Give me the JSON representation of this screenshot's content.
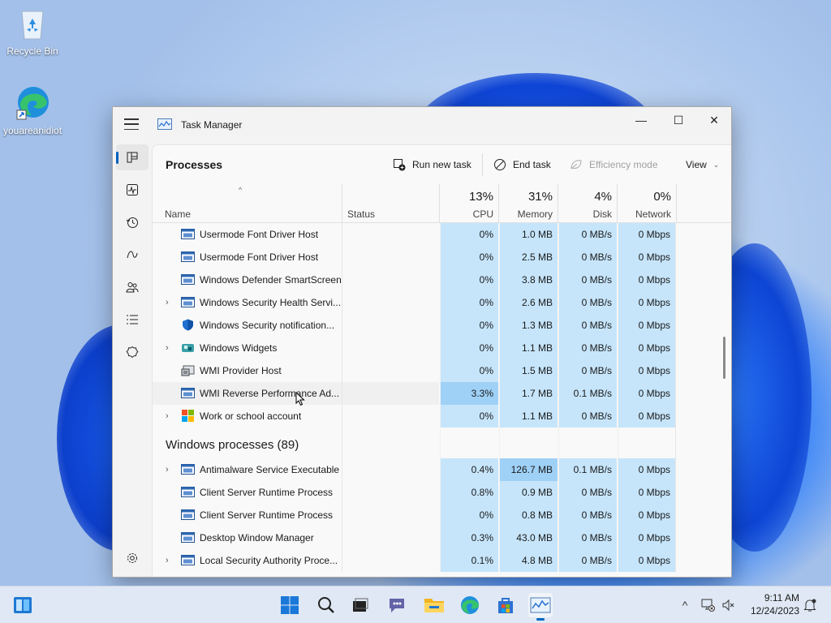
{
  "desktop": {
    "icons": [
      {
        "label": "Recycle Bin",
        "icon": "recycle-bin-icon"
      },
      {
        "label": "youareanidiot",
        "icon": "edge-shortcut-icon"
      }
    ]
  },
  "window": {
    "title": "Task Manager",
    "controls": {
      "minimize": "—",
      "maximize": "☐",
      "close": "✕"
    }
  },
  "nav": [
    {
      "name": "processes",
      "icon": "processes-icon",
      "active": true
    },
    {
      "name": "performance",
      "icon": "performance-icon"
    },
    {
      "name": "app-history",
      "icon": "app-history-icon"
    },
    {
      "name": "startup-apps",
      "icon": "startup-apps-icon"
    },
    {
      "name": "users",
      "icon": "users-icon"
    },
    {
      "name": "details",
      "icon": "details-icon"
    },
    {
      "name": "services",
      "icon": "services-icon"
    },
    {
      "name": "settings",
      "icon": "settings-icon"
    }
  ],
  "commandbar": {
    "page_title": "Processes",
    "run_new_task": "Run new task",
    "end_task": "End task",
    "efficiency_mode": "Efficiency mode",
    "view": "View"
  },
  "columns": {
    "name": "Name",
    "status": "Status",
    "cpu": {
      "pct": "13%",
      "label": "CPU"
    },
    "memory": {
      "pct": "31%",
      "label": "Memory"
    },
    "disk": {
      "pct": "4%",
      "label": "Disk"
    },
    "network": {
      "pct": "0%",
      "label": "Network"
    }
  },
  "rows": [
    {
      "name": "Usermode Font Driver Host",
      "cpu": "0%",
      "memory": "1.0 MB",
      "disk": "0 MB/s",
      "network": "0 Mbps",
      "expandable": false,
      "icon": "app-window-icon"
    },
    {
      "name": "Usermode Font Driver Host",
      "cpu": "0%",
      "memory": "2.5 MB",
      "disk": "0 MB/s",
      "network": "0 Mbps",
      "expandable": false,
      "icon": "app-window-icon"
    },
    {
      "name": "Windows Defender SmartScreen",
      "cpu": "0%",
      "memory": "3.8 MB",
      "disk": "0 MB/s",
      "network": "0 Mbps",
      "expandable": false,
      "icon": "app-window-icon"
    },
    {
      "name": "Windows Security Health Servi...",
      "cpu": "0%",
      "memory": "2.6 MB",
      "disk": "0 MB/s",
      "network": "0 Mbps",
      "expandable": true,
      "icon": "app-window-icon"
    },
    {
      "name": "Windows Security notification...",
      "cpu": "0%",
      "memory": "1.3 MB",
      "disk": "0 MB/s",
      "network": "0 Mbps",
      "expandable": false,
      "icon": "shield-icon"
    },
    {
      "name": "Windows Widgets",
      "cpu": "0%",
      "memory": "1.1 MB",
      "disk": "0 MB/s",
      "network": "0 Mbps",
      "expandable": true,
      "icon": "widgets-icon"
    },
    {
      "name": "WMI Provider Host",
      "cpu": "0%",
      "memory": "1.5 MB",
      "disk": "0 MB/s",
      "network": "0 Mbps",
      "expandable": false,
      "icon": "wmi-icon"
    },
    {
      "name": "WMI Reverse Performance Ad...",
      "cpu": "3.3%",
      "memory": "1.7 MB",
      "disk": "0.1 MB/s",
      "network": "0 Mbps",
      "expandable": false,
      "icon": "app-window-icon",
      "hover": true,
      "hot_cpu": true
    },
    {
      "name": "Work or school account",
      "cpu": "0%",
      "memory": "1.1 MB",
      "disk": "0 MB/s",
      "network": "0 Mbps",
      "expandable": true,
      "icon": "microsoft-logo-icon"
    },
    {
      "group": "Windows processes (89)"
    },
    {
      "name": "Antimalware Service Executable",
      "cpu": "0.4%",
      "memory": "126.7 MB",
      "disk": "0.1 MB/s",
      "network": "0 Mbps",
      "expandable": true,
      "icon": "app-window-icon",
      "hot_mem": true
    },
    {
      "name": "Client Server Runtime Process",
      "cpu": "0.8%",
      "memory": "0.9 MB",
      "disk": "0 MB/s",
      "network": "0 Mbps",
      "expandable": false,
      "icon": "app-window-icon"
    },
    {
      "name": "Client Server Runtime Process",
      "cpu": "0%",
      "memory": "0.8 MB",
      "disk": "0 MB/s",
      "network": "0 Mbps",
      "expandable": false,
      "icon": "app-window-icon"
    },
    {
      "name": "Desktop Window Manager",
      "cpu": "0.3%",
      "memory": "43.0 MB",
      "disk": "0 MB/s",
      "network": "0 Mbps",
      "expandable": false,
      "icon": "app-window-icon"
    },
    {
      "name": "Local Security Authority Proce...",
      "cpu": "0.1%",
      "memory": "4.8 MB",
      "disk": "0 MB/s",
      "network": "0 Mbps",
      "expandable": true,
      "icon": "app-window-icon"
    }
  ],
  "taskbar": {
    "apps": [
      "widgets-icon",
      "start-icon",
      "search-icon",
      "task-view-icon",
      "teams-chat-icon",
      "file-explorer-icon",
      "edge-icon",
      "store-icon",
      "task-manager-icon"
    ],
    "time": "9:11 AM",
    "date": "12/24/2023"
  }
}
